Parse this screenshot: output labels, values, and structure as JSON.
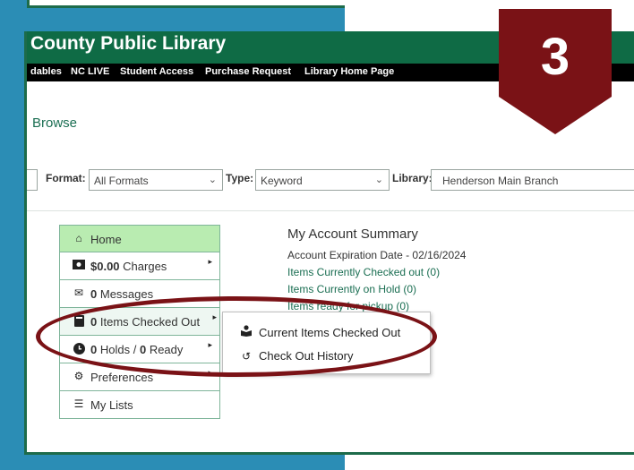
{
  "header": {
    "title": "County Public Library"
  },
  "nav": [
    {
      "label": "dables"
    },
    {
      "label": "NC LIVE"
    },
    {
      "label": "Student Access"
    },
    {
      "label": "Purchase Request"
    },
    {
      "label": "Library Home Page"
    }
  ],
  "browse_label": "Browse",
  "search": {
    "format_label": "Format:",
    "format_value": "All Formats",
    "type_label": "Type:",
    "type_value": "Keyword",
    "library_label": "Library:",
    "library_value": "Henderson Main Branch"
  },
  "menu": {
    "home": "Home",
    "charges_amount": "$0.00",
    "charges_label": "Charges",
    "messages_count": "0",
    "messages_label": "Messages",
    "checked_count": "0",
    "checked_label": "Items Checked Out",
    "holds_count": "0",
    "holds_label": "Holds /",
    "ready_count": "0",
    "ready_label": "Ready",
    "preferences": "Preferences",
    "lists": "My Lists"
  },
  "summary": {
    "title": "My Account Summary",
    "expiration": "Account Expiration Date - 02/16/2024",
    "checked_out": "Items Currently Checked out (0)",
    "on_hold": "Items Currently on Hold (0)",
    "ready": "Items ready for pickup (0)"
  },
  "flyout": {
    "current": "Current Items Checked Out",
    "history": "Check Out History"
  },
  "step": {
    "number": "3"
  },
  "colors": {
    "frame_blue": "#2b8db5",
    "header_green": "#0f6b45",
    "active_green": "#b9ecb1",
    "accent_maroon": "#7a1216",
    "link_green": "#1a6e52"
  }
}
